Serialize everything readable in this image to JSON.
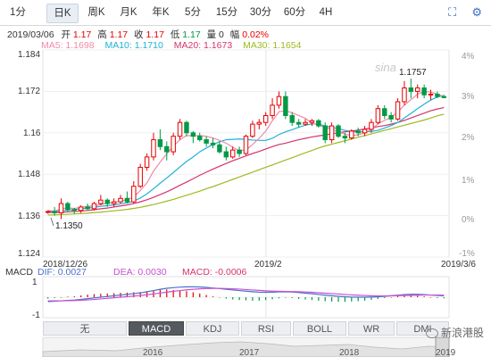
{
  "tabs": [
    "1分",
    "日K",
    "周K",
    "月K",
    "年K",
    "5分",
    "15分",
    "30分",
    "60分",
    "4H"
  ],
  "active_tab": "日K",
  "info": {
    "date": "2019/03/06",
    "open_label": "开",
    "open": "1.17",
    "high_label": "高",
    "high": "1.17",
    "close_label": "收",
    "close": "1.17",
    "low_label": "低",
    "low": "1.17",
    "vol_label": "量",
    "vol": "0",
    "amp_label": "幅",
    "amp": "0.02%"
  },
  "ma": {
    "ma5": "MA5: 1.1698",
    "ma10": "MA10: 1.1710",
    "ma20": "MA20: 1.1673",
    "ma30": "MA30: 1.1654"
  },
  "colors": {
    "up": "#e60000",
    "down": "#009a44",
    "ma5": "#f08aa8",
    "ma10": "#1cb3d8",
    "ma20": "#d6336c",
    "ma30": "#9bbb21",
    "dif": "#4a72c9",
    "dea": "#c84fd1"
  },
  "price_axis": [
    "1.184",
    "1.172",
    "1.16",
    "1.148",
    "1.136",
    "1.124"
  ],
  "pct_axis": [
    "4%",
    "3%",
    "2%",
    "1%",
    "0%",
    "-1%"
  ],
  "annotations": {
    "max": "1.1757",
    "min": "1.1350",
    "watermark": "sina"
  },
  "date_labels": [
    "2018/12/26",
    "2019/2",
    "2019/3/6"
  ],
  "macd_header": {
    "name": "MACD",
    "dif": "DIF: 0.0027",
    "dea": "DEA: 0.0030",
    "macd": "MACD: -0.0006"
  },
  "macd_axis": [
    "1",
    "-1"
  ],
  "indicator_buttons": [
    "无",
    "MACD",
    "KDJ",
    "RSI",
    "BOLL",
    "WR",
    "DMI"
  ],
  "active_indicator": "MACD",
  "overview_years": [
    "2016",
    "2017",
    "2018",
    "2019"
  ],
  "page_watermark": "新浪港股",
  "chart_data": {
    "type": "candlestick",
    "ylim": [
      1.124,
      1.184
    ],
    "candles": [
      [
        1.137,
        1.1375,
        1.1365,
        1.1372
      ],
      [
        1.1372,
        1.1385,
        1.136,
        1.1368
      ],
      [
        1.1368,
        1.141,
        1.135,
        1.1395
      ],
      [
        1.1395,
        1.14,
        1.137,
        1.1378
      ],
      [
        1.1378,
        1.1382,
        1.1365,
        1.1375
      ],
      [
        1.1375,
        1.139,
        1.1368,
        1.1385
      ],
      [
        1.1385,
        1.1395,
        1.1375,
        1.138
      ],
      [
        1.138,
        1.14,
        1.1375,
        1.1395
      ],
      [
        1.1395,
        1.142,
        1.139,
        1.1405
      ],
      [
        1.1405,
        1.141,
        1.1385,
        1.1395
      ],
      [
        1.1395,
        1.141,
        1.1385,
        1.14
      ],
      [
        1.14,
        1.142,
        1.1395,
        1.141
      ],
      [
        1.141,
        1.143,
        1.1395,
        1.14
      ],
      [
        1.14,
        1.146,
        1.1395,
        1.1445
      ],
      [
        1.1445,
        1.151,
        1.144,
        1.15
      ],
      [
        1.15,
        1.154,
        1.149,
        1.153
      ],
      [
        1.153,
        1.16,
        1.152,
        1.158
      ],
      [
        1.158,
        1.161,
        1.155,
        1.156
      ],
      [
        1.156,
        1.1575,
        1.152,
        1.1545
      ],
      [
        1.1545,
        1.16,
        1.1535,
        1.159
      ],
      [
        1.159,
        1.164,
        1.158,
        1.163
      ],
      [
        1.163,
        1.1635,
        1.159,
        1.16
      ],
      [
        1.16,
        1.1605,
        1.157,
        1.159
      ],
      [
        1.159,
        1.16,
        1.1575,
        1.158
      ],
      [
        1.158,
        1.159,
        1.156,
        1.157
      ],
      [
        1.157,
        1.1585,
        1.1555,
        1.1565
      ],
      [
        1.1565,
        1.1575,
        1.154,
        1.1545
      ],
      [
        1.1545,
        1.156,
        1.152,
        1.153
      ],
      [
        1.153,
        1.156,
        1.1525,
        1.155
      ],
      [
        1.155,
        1.156,
        1.153,
        1.154
      ],
      [
        1.154,
        1.1595,
        1.1535,
        1.159
      ],
      [
        1.159,
        1.1635,
        1.1585,
        1.1625
      ],
      [
        1.1625,
        1.164,
        1.161,
        1.163
      ],
      [
        1.163,
        1.166,
        1.162,
        1.165
      ],
      [
        1.165,
        1.17,
        1.164,
        1.168
      ],
      [
        1.168,
        1.172,
        1.167,
        1.1705
      ],
      [
        1.1705,
        1.172,
        1.164,
        1.165
      ],
      [
        1.165,
        1.166,
        1.162,
        1.163
      ],
      [
        1.163,
        1.164,
        1.1615,
        1.1625
      ],
      [
        1.1625,
        1.164,
        1.162,
        1.163
      ],
      [
        1.163,
        1.164,
        1.162,
        1.1635
      ],
      [
        1.1635,
        1.164,
        1.1615,
        1.162
      ],
      [
        1.162,
        1.163,
        1.157,
        1.158
      ],
      [
        1.158,
        1.163,
        1.157,
        1.162
      ],
      [
        1.162,
        1.1625,
        1.1585,
        1.159
      ],
      [
        1.159,
        1.16,
        1.157,
        1.1585
      ],
      [
        1.1585,
        1.161,
        1.158,
        1.1605
      ],
      [
        1.1605,
        1.1615,
        1.159,
        1.16
      ],
      [
        1.16,
        1.162,
        1.159,
        1.161
      ],
      [
        1.161,
        1.164,
        1.16,
        1.163
      ],
      [
        1.163,
        1.168,
        1.1625,
        1.167
      ],
      [
        1.167,
        1.168,
        1.164,
        1.165
      ],
      [
        1.165,
        1.166,
        1.163,
        1.164
      ],
      [
        1.164,
        1.17,
        1.1635,
        1.169
      ],
      [
        1.169,
        1.175,
        1.168,
        1.173
      ],
      [
        1.173,
        1.1757,
        1.17,
        1.172
      ],
      [
        1.172,
        1.174,
        1.17,
        1.173
      ],
      [
        1.173,
        1.174,
        1.17,
        1.171
      ],
      [
        1.171,
        1.1725,
        1.1695,
        1.1712
      ],
      [
        1.1712,
        1.172,
        1.17,
        1.1705
      ],
      [
        1.1705,
        1.171,
        1.17,
        1.1702
      ]
    ],
    "ma5": [
      1.1375,
      1.1373,
      1.138,
      1.1382,
      1.1381,
      1.1384,
      1.1387,
      1.1388,
      1.1392,
      1.1396,
      1.1398,
      1.1402,
      1.1406,
      1.1414,
      1.1433,
      1.1455,
      1.1489,
      1.1515,
      1.1539,
      1.1561,
      1.158,
      1.1592,
      1.1591,
      1.1592,
      1.159,
      1.1585,
      1.1578,
      1.157,
      1.1558,
      1.1548,
      1.155,
      1.1566,
      1.1584,
      1.1605,
      1.1635,
      1.1661,
      1.1664,
      1.1658,
      1.165,
      1.1642,
      1.1628,
      1.1623,
      1.1615,
      1.161,
      1.1603,
      1.1596,
      1.1592,
      1.1594,
      1.16,
      1.161,
      1.1626,
      1.1636,
      1.1645,
      1.166,
      1.168,
      1.1696,
      1.1712,
      1.172,
      1.1718,
      1.1712,
      1.1705
    ],
    "ma10": [
      1.1372,
      1.1372,
      1.1374,
      1.1376,
      1.1377,
      1.138,
      1.1382,
      1.1384,
      1.1387,
      1.1389,
      1.1391,
      1.1394,
      1.1397,
      1.1402,
      1.1411,
      1.1423,
      1.1438,
      1.1454,
      1.1469,
      1.1485,
      1.1501,
      1.1517,
      1.153,
      1.1545,
      1.1556,
      1.1566,
      1.1574,
      1.158,
      1.1581,
      1.1582,
      1.1581,
      1.1579,
      1.1578,
      1.1578,
      1.1584,
      1.1595,
      1.1603,
      1.1609,
      1.1616,
      1.1622,
      1.1626,
      1.1625,
      1.162,
      1.1616,
      1.1612,
      1.1607,
      1.1604,
      1.1603,
      1.1603,
      1.1604,
      1.1607,
      1.1614,
      1.1621,
      1.163,
      1.1643,
      1.1656,
      1.167,
      1.1683,
      1.1695,
      1.1704,
      1.1708
    ],
    "ma20": [
      1.137,
      1.1369,
      1.137,
      1.1371,
      1.1372,
      1.1373,
      1.1375,
      1.1377,
      1.138,
      1.1382,
      1.1385,
      1.1388,
      1.1391,
      1.1395,
      1.14,
      1.1406,
      1.1413,
      1.1421,
      1.1429,
      1.1438,
      1.1448,
      1.1457,
      1.1467,
      1.1477,
      1.1486,
      1.1495,
      1.1503,
      1.1511,
      1.1519,
      1.1526,
      1.1533,
      1.154,
      1.1546,
      1.1553,
      1.156,
      1.1566,
      1.157,
      1.1575,
      1.158,
      1.1584,
      1.1588,
      1.1591,
      1.1594,
      1.1597,
      1.16,
      1.1603,
      1.1605,
      1.1608,
      1.1611,
      1.1614,
      1.1618,
      1.1621,
      1.1625,
      1.163,
      1.1636,
      1.1643,
      1.165,
      1.1657,
      1.1664,
      1.1669,
      1.1673
    ],
    "ma30": [
      1.1362,
      1.1362,
      1.1363,
      1.1364,
      1.1365,
      1.1366,
      1.1367,
      1.1369,
      1.137,
      1.1372,
      1.1374,
      1.1376,
      1.1378,
      1.1381,
      1.1384,
      1.1388,
      1.1392,
      1.1397,
      1.1402,
      1.1407,
      1.1413,
      1.1419,
      1.1425,
      1.1431,
      1.1438,
      1.1444,
      1.1451,
      1.1458,
      1.1465,
      1.1472,
      1.1479,
      1.1486,
      1.1493,
      1.15,
      1.1507,
      1.1514,
      1.1521,
      1.1528,
      1.1535,
      1.1542,
      1.1549,
      1.1556,
      1.1562,
      1.1567,
      1.1572,
      1.1577,
      1.1582,
      1.1587,
      1.1592,
      1.1597,
      1.1602,
      1.1607,
      1.1612,
      1.1617,
      1.1622,
      1.1627,
      1.1632,
      1.1637,
      1.1643,
      1.1649,
      1.1654
    ]
  },
  "macd_data": {
    "ylim": [
      -1.3,
      1.3
    ],
    "dif": [
      -0.3,
      -0.28,
      -0.25,
      -0.22,
      -0.2,
      -0.15,
      -0.1,
      -0.05,
      0.0,
      0.05,
      0.1,
      0.15,
      0.2,
      0.25,
      0.3,
      0.38,
      0.46,
      0.55,
      0.62,
      0.66,
      0.7,
      0.72,
      0.72,
      0.71,
      0.68,
      0.64,
      0.6,
      0.55,
      0.5,
      0.46,
      0.42,
      0.38,
      0.35,
      0.34,
      0.35,
      0.37,
      0.38,
      0.36,
      0.32,
      0.28,
      0.24,
      0.19,
      0.14,
      0.1,
      0.06,
      0.03,
      0.01,
      0.0,
      0.0,
      0.01,
      0.03,
      0.06,
      0.1,
      0.14,
      0.18,
      0.2,
      0.2,
      0.18,
      0.15,
      0.12,
      0.1
    ],
    "dea": [
      -0.25,
      -0.25,
      -0.25,
      -0.24,
      -0.23,
      -0.21,
      -0.19,
      -0.16,
      -0.12,
      -0.08,
      -0.04,
      0.0,
      0.04,
      0.08,
      0.12,
      0.17,
      0.23,
      0.29,
      0.35,
      0.41,
      0.46,
      0.51,
      0.55,
      0.58,
      0.6,
      0.61,
      0.61,
      0.6,
      0.58,
      0.56,
      0.53,
      0.5,
      0.47,
      0.44,
      0.42,
      0.41,
      0.4,
      0.39,
      0.38,
      0.36,
      0.34,
      0.31,
      0.28,
      0.25,
      0.22,
      0.19,
      0.16,
      0.14,
      0.12,
      0.1,
      0.09,
      0.09,
      0.1,
      0.11,
      0.12,
      0.13,
      0.14,
      0.15,
      0.15,
      0.15,
      0.14
    ]
  }
}
